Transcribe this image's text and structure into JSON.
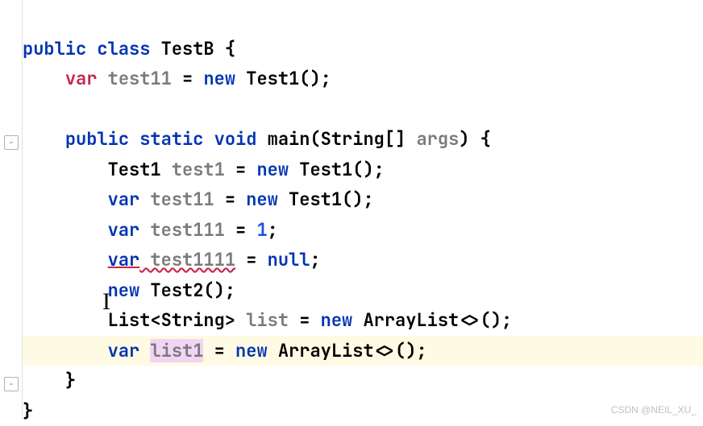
{
  "code": {
    "line1": {
      "kw1": "public",
      "kw2": "class",
      "name": "TestB",
      "brace": " {"
    },
    "line2": {
      "indent": "    ",
      "var": "var",
      "name": " test11 ",
      "eq": "= ",
      "new": "new",
      "call": " Test1();"
    },
    "line4": {
      "indent": "    ",
      "kw1": "public",
      "kw2": " static",
      "kw3": " void",
      "method": " main",
      "paren1": "(",
      "type": "String[] ",
      "arg": "args",
      "paren2": ") {"
    },
    "line5": {
      "indent": "        ",
      "type": "Test1 ",
      "name": "test1",
      "eq": " = ",
      "new": "new",
      "call": " Test1();"
    },
    "line6": {
      "indent": "        ",
      "var": "var",
      "name": " test11 ",
      "eq": "= ",
      "new": "new",
      "call": " Test1();"
    },
    "line7": {
      "indent": "        ",
      "var": "var",
      "name": " test111 ",
      "eq": "= ",
      "val": "1",
      "semi": ";"
    },
    "line8": {
      "indent": "        ",
      "var": "var",
      "name": " test1111",
      "eq": " = ",
      "null": "null",
      "semi": ";"
    },
    "line9": {
      "indent": "        ",
      "new": "new",
      "call": " Test2();"
    },
    "line10": {
      "indent": "        ",
      "type": "List<String> ",
      "name": "list",
      "eq": " = ",
      "new": "new",
      "call": " ArrayList<>();"
    },
    "line11": {
      "indent": "        ",
      "var": "var",
      "sp": " ",
      "name": "list1",
      "eq": " = ",
      "new": "new",
      "call": " ArrayList<>();"
    },
    "line12": {
      "indent": "    ",
      "brace": "}"
    },
    "line13": {
      "brace": "}"
    }
  },
  "watermark": "CSDN @NEIL_XU_"
}
